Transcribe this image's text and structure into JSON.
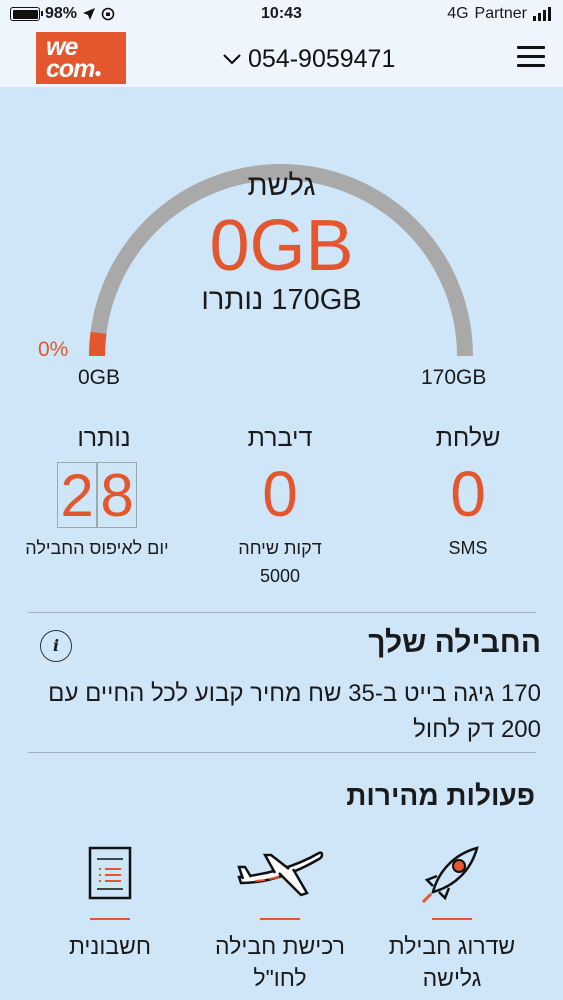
{
  "status_bar": {
    "battery": "98%",
    "time": "10:43",
    "network": "4G",
    "carrier": "Partner"
  },
  "header": {
    "logo_line1": "we",
    "logo_line2": "com",
    "phone_number": "054-9059471"
  },
  "gauge": {
    "title": "גלשת",
    "used": "0GB",
    "remaining": "170GB נותרו",
    "percent": "0%",
    "min_label": "0GB",
    "max_label": "170GB",
    "used_fraction": 0.0,
    "track_color": "#a9a9a9",
    "accent_color": "#e4572e"
  },
  "stats": {
    "sms": {
      "label": "שלחת",
      "value": "0",
      "sub": "SMS"
    },
    "talk": {
      "label": "דיברת",
      "value": "0",
      "sub_line1": "דקות שיחה",
      "sub_line2": "5000"
    },
    "days": {
      "label": "נותרו",
      "digit1": "2",
      "digit2": "8",
      "sub": "יום לאיפוס החבילה"
    }
  },
  "package": {
    "title": "החבילה שלך",
    "info_icon": "i",
    "description": "170 גיגה בייט ב-35 שח מחיר קבוע לכל החיים עם 200 דק לחול"
  },
  "quick_actions": {
    "title": "פעולות מהירות",
    "items": [
      {
        "icon": "rocket-icon",
        "label_line1": "שדרוג חבילת",
        "label_line2": "גלישה"
      },
      {
        "icon": "airplane-icon",
        "label_line1": "רכישת חבילה",
        "label_line2": "לחו\"ל"
      },
      {
        "icon": "invoice-icon",
        "label_line1": "חשבונית",
        "label_line2": ""
      }
    ]
  }
}
